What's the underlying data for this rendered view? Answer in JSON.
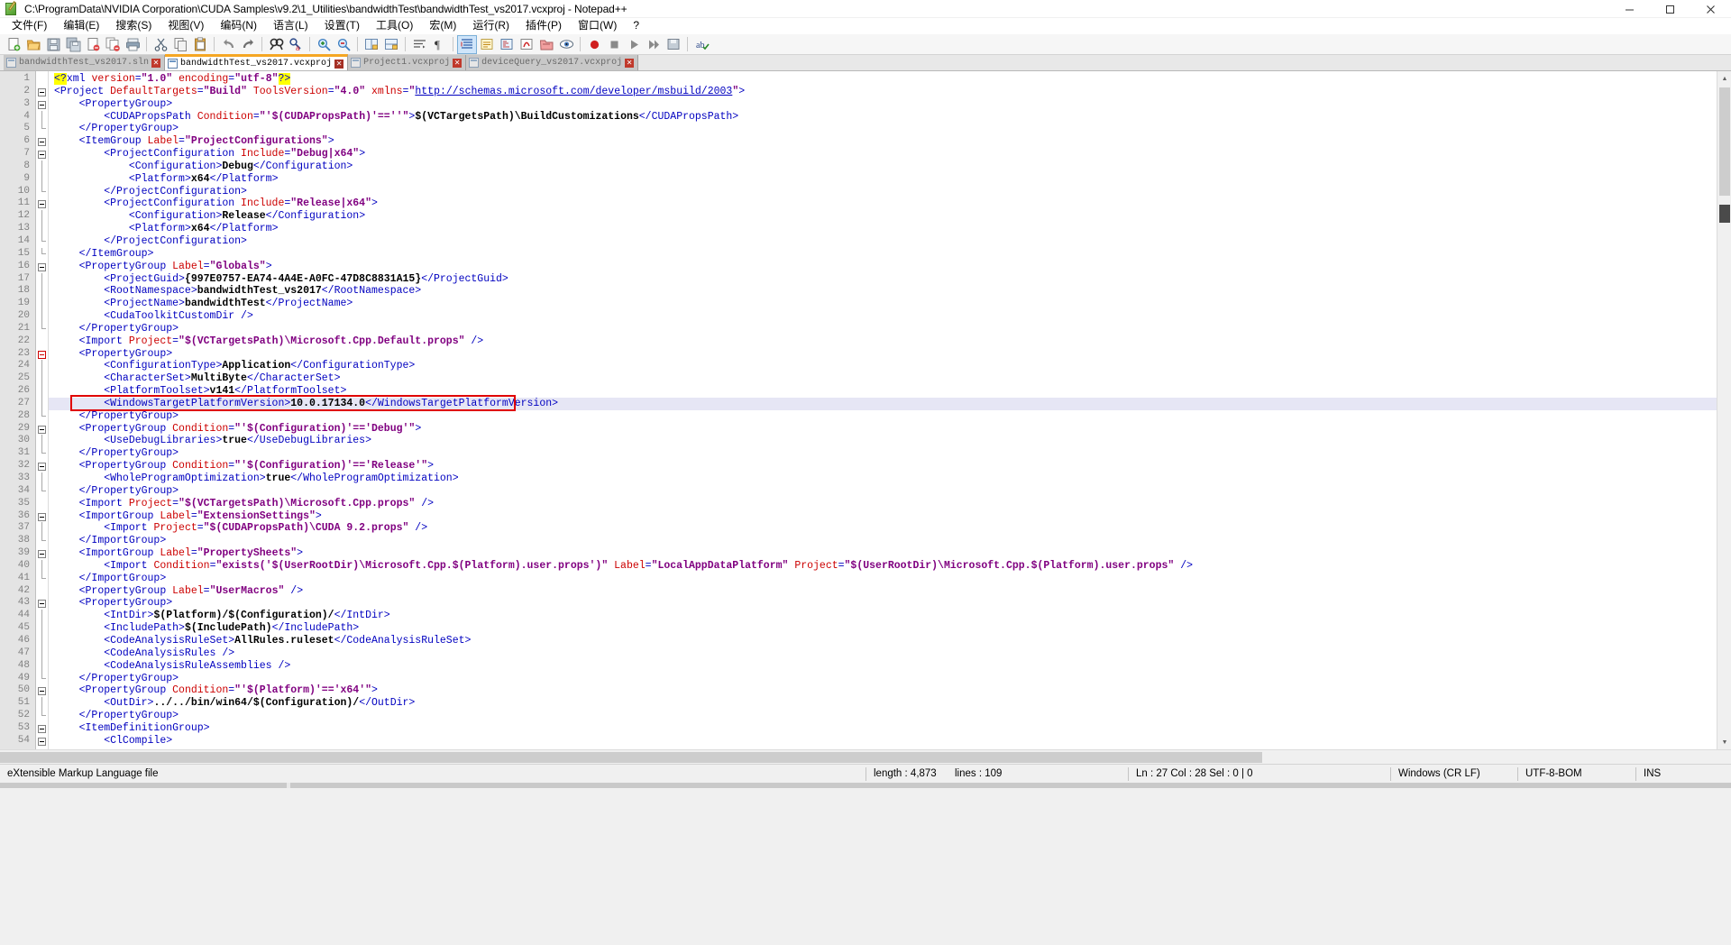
{
  "window": {
    "title": "C:\\ProgramData\\NVIDIA Corporation\\CUDA Samples\\v9.2\\1_Utilities\\bandwidthTest\\bandwidthTest_vs2017.vcxproj - Notepad++",
    "app_icon": "notepad-plus-plus-icon",
    "minimize_label": "─",
    "maximize_label": "☐",
    "close_label": "✕"
  },
  "menu": {
    "items": [
      {
        "label": "文件(F)",
        "name": "menu-file"
      },
      {
        "label": "编辑(E)",
        "name": "menu-edit"
      },
      {
        "label": "搜索(S)",
        "name": "menu-search"
      },
      {
        "label": "视图(V)",
        "name": "menu-view"
      },
      {
        "label": "编码(N)",
        "name": "menu-encoding"
      },
      {
        "label": "语言(L)",
        "name": "menu-language"
      },
      {
        "label": "设置(T)",
        "name": "menu-settings"
      },
      {
        "label": "工具(O)",
        "name": "menu-tools"
      },
      {
        "label": "宏(M)",
        "name": "menu-macro"
      },
      {
        "label": "运行(R)",
        "name": "menu-run"
      },
      {
        "label": "插件(P)",
        "name": "menu-plugins"
      },
      {
        "label": "窗口(W)",
        "name": "menu-window"
      },
      {
        "label": "?",
        "name": "menu-help"
      }
    ]
  },
  "toolbar": {
    "buttons": [
      {
        "name": "new-file-icon",
        "group": 1
      },
      {
        "name": "open-file-icon",
        "group": 1
      },
      {
        "name": "save-icon",
        "group": 1
      },
      {
        "name": "save-all-icon",
        "group": 1
      },
      {
        "name": "close-file-icon",
        "group": 1
      },
      {
        "name": "close-all-icon",
        "group": 1
      },
      {
        "name": "print-icon",
        "group": 1
      },
      {
        "name": "cut-icon",
        "group": 2
      },
      {
        "name": "copy-icon",
        "group": 2
      },
      {
        "name": "paste-icon",
        "group": 2
      },
      {
        "name": "undo-icon",
        "group": 3
      },
      {
        "name": "redo-icon",
        "group": 3
      },
      {
        "name": "find-icon",
        "group": 4
      },
      {
        "name": "replace-icon",
        "group": 4
      },
      {
        "name": "zoom-in-icon",
        "group": 5
      },
      {
        "name": "zoom-out-icon",
        "group": 5
      },
      {
        "name": "sync-vertical-scroll-icon",
        "group": 6
      },
      {
        "name": "sync-horizontal-scroll-icon",
        "group": 6
      },
      {
        "name": "word-wrap-icon",
        "group": 7
      },
      {
        "name": "show-all-chars-icon",
        "group": 7
      },
      {
        "name": "indent-guide-icon",
        "group": 8,
        "active": true
      },
      {
        "name": "user-defined-language-icon",
        "group": 8
      },
      {
        "name": "document-map-icon",
        "group": 8
      },
      {
        "name": "function-list-icon",
        "group": 8
      },
      {
        "name": "folder-as-workspace-icon",
        "group": 8
      },
      {
        "name": "monitoring-icon",
        "group": 8
      },
      {
        "name": "macro-record-icon",
        "group": 9
      },
      {
        "name": "macro-stop-icon",
        "group": 9
      },
      {
        "name": "macro-play-icon",
        "group": 9
      },
      {
        "name": "macro-playmany-icon",
        "group": 9
      },
      {
        "name": "macro-save-icon",
        "group": 9
      },
      {
        "name": "spellcheck-icon",
        "group": 10
      }
    ]
  },
  "tabs": [
    {
      "label": "bandwidthTest_vs2017.sln",
      "active": false,
      "name": "tab-bandwidthtest-sln"
    },
    {
      "label": "bandwidthTest_vs2017.vcxproj",
      "active": true,
      "name": "tab-bandwidthtest-vcxproj"
    },
    {
      "label": "Project1.vcxproj",
      "active": false,
      "name": "tab-project1-vcxproj"
    },
    {
      "label": "deviceQuery_vs2017.vcxproj",
      "active": false,
      "name": "tab-devicequery-vcxproj"
    }
  ],
  "editor": {
    "highlighted_line": 27,
    "annotation_color": "#e00000",
    "lines": [
      {
        "n": 1,
        "fold": "none",
        "indent": 0,
        "html": "<span class=\"pi\">&lt;?</span><span class=\"tg\">xml</span> <span class=\"at\">version</span><span class=\"tg\">=</span><span class=\"st\">\"1.0\"</span> <span class=\"at\">encoding</span><span class=\"tg\">=</span><span class=\"st\">\"utf-8\"</span><span class=\"pi\">?&gt;</span>"
      },
      {
        "n": 2,
        "fold": "open",
        "indent": 0,
        "html": "<span class=\"tg\">&lt;Project </span><span class=\"at\">DefaultTargets</span><span class=\"tg\">=</span><span class=\"st\">\"Build\"</span> <span class=\"at\">ToolsVersion</span><span class=\"tg\">=</span><span class=\"st\">\"4.0\"</span> <span class=\"at\">xmlns</span><span class=\"tg\">=</span><span class=\"st\">\"</span><span class=\"lnk\">http://schemas.microsoft.com/developer/msbuild/2003</span><span class=\"st\">\"</span><span class=\"tg\">&gt;</span>"
      },
      {
        "n": 3,
        "fold": "open",
        "indent": 1,
        "html": "<span class=\"tg\">&lt;PropertyGroup&gt;</span>"
      },
      {
        "n": 4,
        "fold": "line",
        "indent": 2,
        "html": "<span class=\"tg\">&lt;CUDAPropsPath </span><span class=\"at\">Condition</span><span class=\"tg\">=</span><span class=\"st\">\"'$(CUDAPropsPath)'==''\"</span><span class=\"tg\">&gt;</span><span class=\"tx\">$(VCTargetsPath)\\BuildCustomizations</span><span class=\"tg\">&lt;/CUDAPropsPath&gt;</span>"
      },
      {
        "n": 5,
        "fold": "end",
        "indent": 1,
        "html": "<span class=\"tg\">&lt;/PropertyGroup&gt;</span>"
      },
      {
        "n": 6,
        "fold": "open",
        "indent": 1,
        "html": "<span class=\"tg\">&lt;ItemGroup </span><span class=\"at\">Label</span><span class=\"tg\">=</span><span class=\"st\">\"ProjectConfigurations\"</span><span class=\"tg\">&gt;</span>"
      },
      {
        "n": 7,
        "fold": "open",
        "indent": 2,
        "html": "<span class=\"tg\">&lt;ProjectConfiguration </span><span class=\"at\">Include</span><span class=\"tg\">=</span><span class=\"st\">\"Debug|x64\"</span><span class=\"tg\">&gt;</span>"
      },
      {
        "n": 8,
        "fold": "line",
        "indent": 3,
        "html": "<span class=\"tg\">&lt;Configuration&gt;</span><span class=\"tx\">Debug</span><span class=\"tg\">&lt;/Configuration&gt;</span>"
      },
      {
        "n": 9,
        "fold": "line",
        "indent": 3,
        "html": "<span class=\"tg\">&lt;Platform&gt;</span><span class=\"tx\">x64</span><span class=\"tg\">&lt;/Platform&gt;</span>"
      },
      {
        "n": 10,
        "fold": "end",
        "indent": 2,
        "html": "<span class=\"tg\">&lt;/ProjectConfiguration&gt;</span>"
      },
      {
        "n": 11,
        "fold": "open",
        "indent": 2,
        "html": "<span class=\"tg\">&lt;ProjectConfiguration </span><span class=\"at\">Include</span><span class=\"tg\">=</span><span class=\"st\">\"Release|x64\"</span><span class=\"tg\">&gt;</span>"
      },
      {
        "n": 12,
        "fold": "line",
        "indent": 3,
        "html": "<span class=\"tg\">&lt;Configuration&gt;</span><span class=\"tx\">Release</span><span class=\"tg\">&lt;/Configuration&gt;</span>"
      },
      {
        "n": 13,
        "fold": "line",
        "indent": 3,
        "html": "<span class=\"tg\">&lt;Platform&gt;</span><span class=\"tx\">x64</span><span class=\"tg\">&lt;/Platform&gt;</span>"
      },
      {
        "n": 14,
        "fold": "end",
        "indent": 2,
        "html": "<span class=\"tg\">&lt;/ProjectConfiguration&gt;</span>"
      },
      {
        "n": 15,
        "fold": "end",
        "indent": 1,
        "html": "<span class=\"tg\">&lt;/ItemGroup&gt;</span>"
      },
      {
        "n": 16,
        "fold": "open",
        "indent": 1,
        "html": "<span class=\"tg\">&lt;PropertyGroup </span><span class=\"at\">Label</span><span class=\"tg\">=</span><span class=\"st\">\"Globals\"</span><span class=\"tg\">&gt;</span>"
      },
      {
        "n": 17,
        "fold": "line",
        "indent": 2,
        "html": "<span class=\"tg\">&lt;ProjectGuid&gt;</span><span class=\"tx\">{997E0757-EA74-4A4E-A0FC-47D8C8831A15}</span><span class=\"tg\">&lt;/ProjectGuid&gt;</span>"
      },
      {
        "n": 18,
        "fold": "line",
        "indent": 2,
        "html": "<span class=\"tg\">&lt;RootNamespace&gt;</span><span class=\"tx\">bandwidthTest_vs2017</span><span class=\"tg\">&lt;/RootNamespace&gt;</span>"
      },
      {
        "n": 19,
        "fold": "line",
        "indent": 2,
        "html": "<span class=\"tg\">&lt;ProjectName&gt;</span><span class=\"tx\">bandwidthTest</span><span class=\"tg\">&lt;/ProjectName&gt;</span>"
      },
      {
        "n": 20,
        "fold": "line",
        "indent": 2,
        "html": "<span class=\"tg\">&lt;CudaToolkitCustomDir /&gt;</span>"
      },
      {
        "n": 21,
        "fold": "end",
        "indent": 1,
        "html": "<span class=\"tg\">&lt;/PropertyGroup&gt;</span>"
      },
      {
        "n": 22,
        "fold": "none",
        "indent": 1,
        "html": "<span class=\"tg\">&lt;Import </span><span class=\"at\">Project</span><span class=\"tg\">=</span><span class=\"st\">\"$(VCTargetsPath)\\Microsoft.Cpp.Default.props\"</span><span class=\"tg\"> /&gt;</span>"
      },
      {
        "n": 23,
        "fold": "openred",
        "indent": 1,
        "html": "<span class=\"tg\">&lt;PropertyGroup&gt;</span>"
      },
      {
        "n": 24,
        "fold": "line",
        "indent": 2,
        "html": "<span class=\"tg\">&lt;ConfigurationType&gt;</span><span class=\"tx\">Application</span><span class=\"tg\">&lt;/ConfigurationType&gt;</span>"
      },
      {
        "n": 25,
        "fold": "line",
        "indent": 2,
        "html": "<span class=\"tg\">&lt;CharacterSet&gt;</span><span class=\"tx\">MultiByte</span><span class=\"tg\">&lt;/CharacterSet&gt;</span>"
      },
      {
        "n": 26,
        "fold": "line",
        "indent": 2,
        "html": "<span class=\"tg\">&lt;PlatformToolset&gt;</span><span class=\"tx\">v141</span><span class=\"tg\">&lt;/PlatformToolset&gt;</span>"
      },
      {
        "n": 27,
        "fold": "line",
        "indent": 2,
        "html": "<span class=\"tg\">&lt;WindowsTargetPlatformVersion&gt;</span><span class=\"tx\">10.0.17134.0</span><span class=\"tg\">&lt;/WindowsTargetPlatformVersion&gt;</span>"
      },
      {
        "n": 28,
        "fold": "end",
        "indent": 1,
        "html": "<span class=\"tg\">&lt;/PropertyGroup&gt;</span>"
      },
      {
        "n": 29,
        "fold": "open",
        "indent": 1,
        "html": "<span class=\"tg\">&lt;PropertyGroup </span><span class=\"at\">Condition</span><span class=\"tg\">=</span><span class=\"st\">\"'$(Configuration)'=='Debug'\"</span><span class=\"tg\">&gt;</span>"
      },
      {
        "n": 30,
        "fold": "line",
        "indent": 2,
        "html": "<span class=\"tg\">&lt;UseDebugLibraries&gt;</span><span class=\"tx\">true</span><span class=\"tg\">&lt;/UseDebugLibraries&gt;</span>"
      },
      {
        "n": 31,
        "fold": "end",
        "indent": 1,
        "html": "<span class=\"tg\">&lt;/PropertyGroup&gt;</span>"
      },
      {
        "n": 32,
        "fold": "open",
        "indent": 1,
        "html": "<span class=\"tg\">&lt;PropertyGroup </span><span class=\"at\">Condition</span><span class=\"tg\">=</span><span class=\"st\">\"'$(Configuration)'=='Release'\"</span><span class=\"tg\">&gt;</span>"
      },
      {
        "n": 33,
        "fold": "line",
        "indent": 2,
        "html": "<span class=\"tg\">&lt;WholeProgramOptimization&gt;</span><span class=\"tx\">true</span><span class=\"tg\">&lt;/WholeProgramOptimization&gt;</span>"
      },
      {
        "n": 34,
        "fold": "end",
        "indent": 1,
        "html": "<span class=\"tg\">&lt;/PropertyGroup&gt;</span>"
      },
      {
        "n": 35,
        "fold": "none",
        "indent": 1,
        "html": "<span class=\"tg\">&lt;Import </span><span class=\"at\">Project</span><span class=\"tg\">=</span><span class=\"st\">\"$(VCTargetsPath)\\Microsoft.Cpp.props\"</span><span class=\"tg\"> /&gt;</span>"
      },
      {
        "n": 36,
        "fold": "open",
        "indent": 1,
        "html": "<span class=\"tg\">&lt;ImportGroup </span><span class=\"at\">Label</span><span class=\"tg\">=</span><span class=\"st\">\"ExtensionSettings\"</span><span class=\"tg\">&gt;</span>"
      },
      {
        "n": 37,
        "fold": "line",
        "indent": 2,
        "html": "<span class=\"tg\">&lt;Import </span><span class=\"at\">Project</span><span class=\"tg\">=</span><span class=\"st\">\"$(CUDAPropsPath)\\CUDA 9.2.props\"</span><span class=\"tg\"> /&gt;</span>"
      },
      {
        "n": 38,
        "fold": "end",
        "indent": 1,
        "html": "<span class=\"tg\">&lt;/ImportGroup&gt;</span>"
      },
      {
        "n": 39,
        "fold": "open",
        "indent": 1,
        "html": "<span class=\"tg\">&lt;ImportGroup </span><span class=\"at\">Label</span><span class=\"tg\">=</span><span class=\"st\">\"PropertySheets\"</span><span class=\"tg\">&gt;</span>"
      },
      {
        "n": 40,
        "fold": "line",
        "indent": 2,
        "html": "<span class=\"tg\">&lt;Import </span><span class=\"at\">Condition</span><span class=\"tg\">=</span><span class=\"st\">\"exists('$(UserRootDir)\\Microsoft.Cpp.$(Platform).user.props')\"</span> <span class=\"at\">Label</span><span class=\"tg\">=</span><span class=\"st\">\"LocalAppDataPlatform\"</span> <span class=\"at\">Project</span><span class=\"tg\">=</span><span class=\"st\">\"$(UserRootDir)\\Microsoft.Cpp.$(Platform).user.props\"</span><span class=\"tg\"> /&gt;</span>"
      },
      {
        "n": 41,
        "fold": "end",
        "indent": 1,
        "html": "<span class=\"tg\">&lt;/ImportGroup&gt;</span>"
      },
      {
        "n": 42,
        "fold": "none",
        "indent": 1,
        "html": "<span class=\"tg\">&lt;PropertyGroup </span><span class=\"at\">Label</span><span class=\"tg\">=</span><span class=\"st\">\"UserMacros\"</span><span class=\"tg\"> /&gt;</span>"
      },
      {
        "n": 43,
        "fold": "open",
        "indent": 1,
        "html": "<span class=\"tg\">&lt;PropertyGroup&gt;</span>"
      },
      {
        "n": 44,
        "fold": "line",
        "indent": 2,
        "html": "<span class=\"tg\">&lt;IntDir&gt;</span><span class=\"tx\">$(Platform)/$(Configuration)/</span><span class=\"tg\">&lt;/IntDir&gt;</span>"
      },
      {
        "n": 45,
        "fold": "line",
        "indent": 2,
        "html": "<span class=\"tg\">&lt;IncludePath&gt;</span><span class=\"tx\">$(IncludePath)</span><span class=\"tg\">&lt;/IncludePath&gt;</span>"
      },
      {
        "n": 46,
        "fold": "line",
        "indent": 2,
        "html": "<span class=\"tg\">&lt;CodeAnalysisRuleSet&gt;</span><span class=\"tx\">AllRules.ruleset</span><span class=\"tg\">&lt;/CodeAnalysisRuleSet&gt;</span>"
      },
      {
        "n": 47,
        "fold": "line",
        "indent": 2,
        "html": "<span class=\"tg\">&lt;CodeAnalysisRules /&gt;</span>"
      },
      {
        "n": 48,
        "fold": "line",
        "indent": 2,
        "html": "<span class=\"tg\">&lt;CodeAnalysisRuleAssemblies /&gt;</span>"
      },
      {
        "n": 49,
        "fold": "end",
        "indent": 1,
        "html": "<span class=\"tg\">&lt;/PropertyGroup&gt;</span>"
      },
      {
        "n": 50,
        "fold": "open",
        "indent": 1,
        "html": "<span class=\"tg\">&lt;PropertyGroup </span><span class=\"at\">Condition</span><span class=\"tg\">=</span><span class=\"st\">\"'$(Platform)'=='x64'\"</span><span class=\"tg\">&gt;</span>"
      },
      {
        "n": 51,
        "fold": "line",
        "indent": 2,
        "html": "<span class=\"tg\">&lt;OutDir&gt;</span><span class=\"tx\">../../bin/win64/$(Configuration)/</span><span class=\"tg\">&lt;/OutDir&gt;</span>"
      },
      {
        "n": 52,
        "fold": "end",
        "indent": 1,
        "html": "<span class=\"tg\">&lt;/PropertyGroup&gt;</span>"
      },
      {
        "n": 53,
        "fold": "open",
        "indent": 1,
        "html": "<span class=\"tg\">&lt;ItemDefinitionGroup&gt;</span>"
      },
      {
        "n": 54,
        "fold": "open",
        "indent": 2,
        "html": "<span class=\"tg\">&lt;ClCompile&gt;</span>"
      }
    ]
  },
  "statusbar": {
    "doc_type": "eXtensible Markup Language file",
    "length_label": "length : 4,873",
    "lines_label": "lines : 109",
    "position": "Ln : 27    Col : 28    Sel : 0 | 0",
    "eol": "Windows (CR LF)",
    "encoding": "UTF-8-BOM",
    "insert_mode": "INS"
  }
}
